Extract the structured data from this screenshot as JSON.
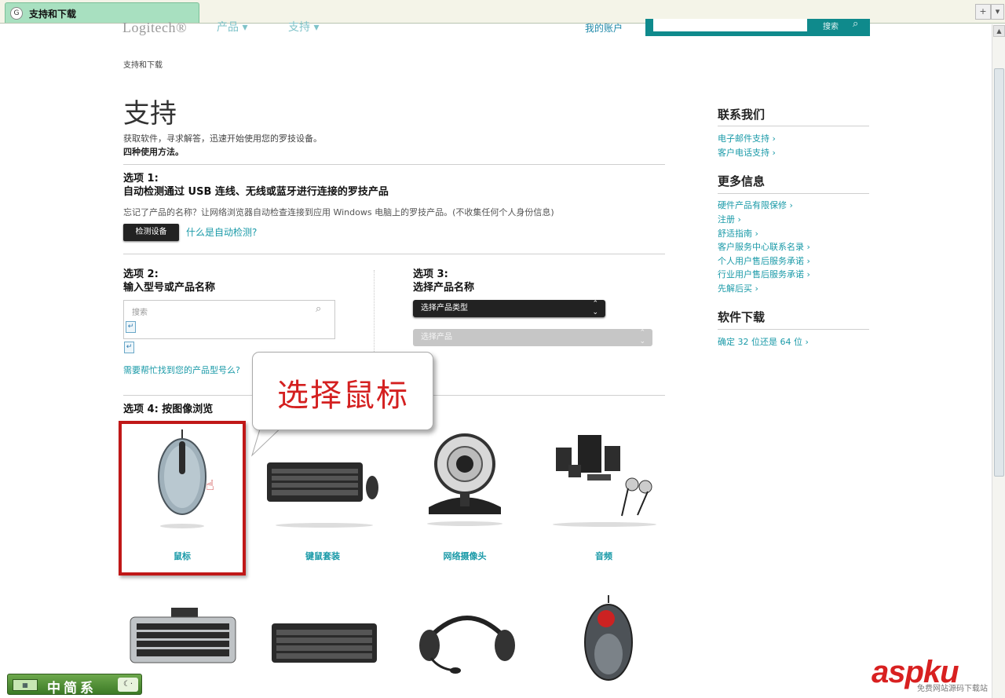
{
  "browser": {
    "tab_title": "支持和下载"
  },
  "header": {
    "logo": "Logitech®",
    "nav_products": "产品 ▾",
    "nav_support": "支持 ▾",
    "my_account": "我的账户",
    "search_label": "搜索"
  },
  "breadcrumb": "支持和下载",
  "page_title": "支持",
  "intro": {
    "line1": "获取软件，寻求解答，迅速开始使用您的罗技设备。",
    "line2": "四种使用方法。"
  },
  "option1": {
    "label": "选项 1:",
    "title": "自动检测通过 USB 连线、无线或蓝牙进行连接的罗技产品",
    "desc": "忘记了产品的名称？让网络浏览器自动检查连接到应用 Windows 电脑上的罗技产品。(不收集任何个人身份信息)",
    "button": "检测设备",
    "link": "什么是自动检测?"
  },
  "option2": {
    "label": "选项 2:",
    "title": "输入型号或产品名称",
    "placeholder": "搜索",
    "help_link": "需要帮忙找到您的产品型号么?"
  },
  "option3": {
    "label": "选项 3:",
    "title": "选择产品名称",
    "select_type": "选择产品类型",
    "select_product": "选择产品"
  },
  "option4": {
    "title": "选项 4: 按图像浏览",
    "products": [
      "鼠标",
      "键鼠套装",
      "网络摄像头",
      "音频"
    ]
  },
  "callout_text": "选择鼠标",
  "sidebar": {
    "contact_title": "联系我们",
    "contact_links": [
      "电子邮件支持 ›",
      "客户电话支持 ›"
    ],
    "more_title": "更多信息",
    "more_links": [
      "硬件产品有限保修 ›",
      "注册 ›",
      "舒适指南 ›",
      "客户服务中心联系名录 ›",
      "个人用户售后服务承诺 ›",
      "行业用户售后服务承诺 ›",
      "先解后买 ›"
    ],
    "download_title": "软件下载",
    "download_links": [
      "确定 32 位还是 64 位 ›"
    ]
  },
  "ime_bar": "中简系",
  "watermark": {
    "brand": "aspku",
    "sub": "免费网站源码下载站"
  },
  "colors": {
    "link": "#1a9aa8",
    "callout_text": "#d42020",
    "highlight_border": "#c01818",
    "search_bar": "#0f8a8c"
  }
}
